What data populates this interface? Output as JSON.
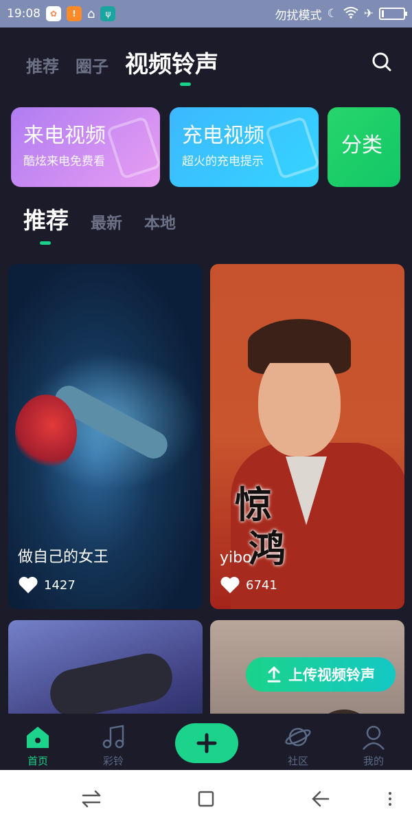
{
  "status_bar": {
    "time": "19:08",
    "dnd_label": "勿扰模式",
    "icons": [
      "app-icon",
      "warning-icon",
      "cleaner-icon",
      "usb-icon",
      "moon-icon",
      "wifi-icon",
      "airplane-icon",
      "battery-icon"
    ]
  },
  "top_tabs": [
    {
      "label": "推荐",
      "active": false
    },
    {
      "label": "圈子",
      "active": false
    },
    {
      "label": "视频铃声",
      "active": true
    }
  ],
  "categories": [
    {
      "title": "来电视频",
      "subtitle": "酷炫来电免费看"
    },
    {
      "title": "充电视频",
      "subtitle": "超火的充电提示"
    },
    {
      "title": "分类",
      "subtitle": ""
    }
  ],
  "sub_tabs": [
    {
      "label": "推荐",
      "active": true
    },
    {
      "label": "最新",
      "active": false
    },
    {
      "label": "本地",
      "active": false
    }
  ],
  "videos": [
    {
      "title": "做自己的女王",
      "likes": "1427"
    },
    {
      "title": "yibo",
      "likes": "6741",
      "overlay_text": "惊\n鸿"
    },
    {
      "title": "",
      "likes": ""
    },
    {
      "title": "",
      "likes": ""
    }
  ],
  "upload_button": {
    "label": "上传视频铃声"
  },
  "bottom_nav": [
    {
      "label": "首页",
      "active": true
    },
    {
      "label": "彩铃",
      "active": false
    },
    {
      "label": "社区",
      "active": false
    },
    {
      "label": "我的",
      "active": false
    }
  ],
  "colors": {
    "accent": "#1bd38a",
    "background": "#1b1b29",
    "inactive_text": "#6d7186"
  }
}
